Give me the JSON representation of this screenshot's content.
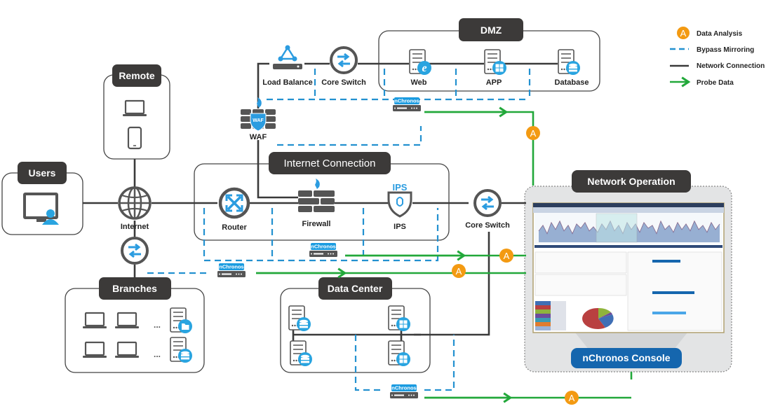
{
  "legend": {
    "items": [
      {
        "icon": "analysis-badge-icon",
        "badge": "A",
        "label": "Data Analysis"
      },
      {
        "icon": "dashed-line-icon",
        "label": "Bypass Mirroring"
      },
      {
        "icon": "solid-line-icon",
        "label": "Network Connection"
      },
      {
        "icon": "green-arrow-icon",
        "label": "Probe Data"
      }
    ]
  },
  "colors": {
    "network": "#3a3a3a",
    "bypass": "#2391d0",
    "probe": "#22a83a",
    "analysis": "#f39a12",
    "header": "#3c3a39",
    "console_button": "#1566ae"
  },
  "groups": {
    "dmz": "DMZ",
    "remote": "Remote",
    "users": "Users",
    "internet_connection": "Internet Connection",
    "branches": "Branches",
    "data_center": "Data Center",
    "network_operation": "Network Operation"
  },
  "nodes": {
    "load_balance": "Load Balance",
    "core_switch_top": "Core Switch",
    "web": "Web",
    "app": "APP",
    "database": "Database",
    "waf": "WAF",
    "waf_shield": "WAF",
    "internet": "Internet",
    "router": "Router",
    "firewall": "Firewall",
    "ips": "IPS",
    "ips_tag": "IPS",
    "core_switch_mid": "Core Switch"
  },
  "probes": {
    "label": "nChronos",
    "badge": "A"
  },
  "console": {
    "button": "nChronos Console"
  },
  "branches": {
    "ellipsis": "..."
  }
}
